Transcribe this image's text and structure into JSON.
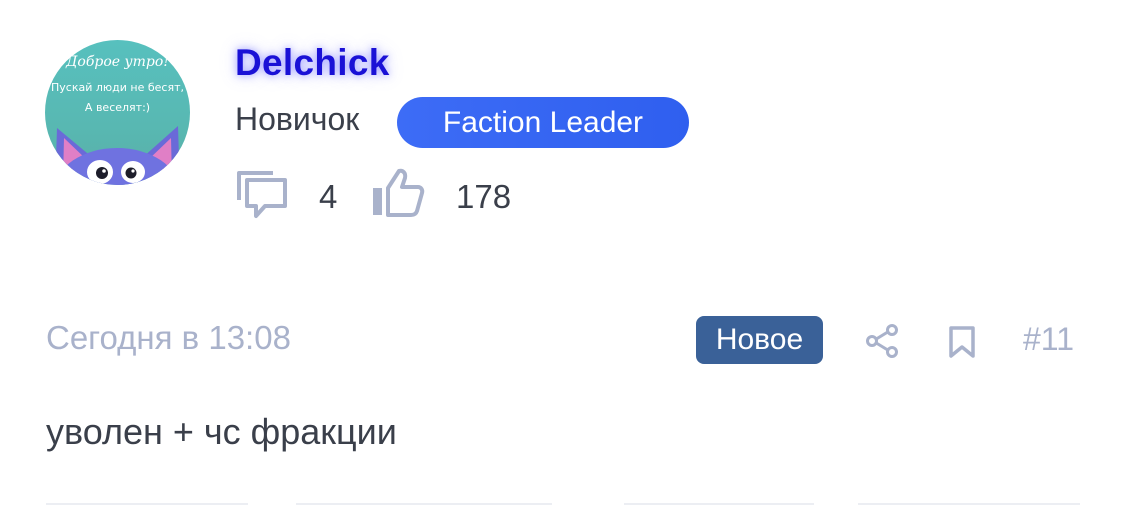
{
  "author": {
    "username": "Delchick",
    "rank": "Новичок",
    "role_badge": "Faction Leader",
    "avatar": {
      "caption_line1": "Доброе утро!",
      "caption_line2": "Пускай люди не бесят,",
      "caption_line3": "А веселят:)",
      "background": "#57c0be",
      "character_color": "#6f72e0"
    },
    "stats": {
      "messages_icon": "message-bubbles-icon",
      "messages_count": "4",
      "likes_icon": "thumbs-up-icon",
      "likes_count": "178"
    }
  },
  "post": {
    "date": "Сегодня в 13:08",
    "new_badge": "Новое",
    "share_icon": "share-icon",
    "bookmark_icon": "bookmark-icon",
    "number": "#11",
    "text": "уволен + чс фракции"
  },
  "colors": {
    "username": "#1a11d6",
    "role_badge": "#3563f2",
    "new_badge": "#3a6198",
    "muted": "#a9b2cb",
    "text": "#3a3f4a"
  }
}
